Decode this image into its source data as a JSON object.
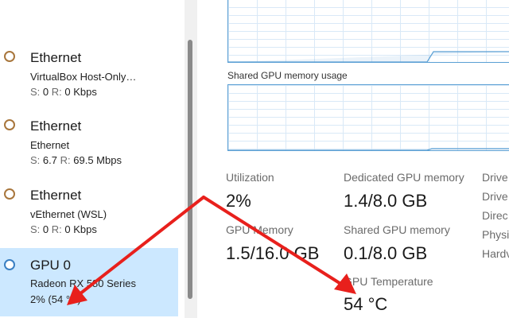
{
  "sidebar": {
    "items": [
      {
        "title": "Ethernet",
        "subtitle": "VirtualBox Host-Only…",
        "send_label": "S:",
        "send_value": "0",
        "recv_label": "R:",
        "recv_value": "0 Kbps"
      },
      {
        "title": "Ethernet",
        "subtitle": "Ethernet",
        "send_label": "S:",
        "send_value": "6.7",
        "recv_label": "R:",
        "recv_value": "69.5 Mbps"
      },
      {
        "title": "Ethernet",
        "subtitle": "vEthernet (WSL)",
        "send_label": "S:",
        "send_value": "0",
        "recv_label": "R:",
        "recv_value": "0 Kbps"
      }
    ],
    "gpu": {
      "title": "GPU 0",
      "subtitle": "Radeon RX 580 Series",
      "usage": "2%",
      "temp": "(54 °C)"
    }
  },
  "graphs": {
    "shared_label": "Shared GPU memory usage"
  },
  "stats": {
    "utilization_label": "Utilization",
    "utilization_value": "2%",
    "dedicated_label": "Dedicated GPU memory",
    "dedicated_value": "1.4/8.0 GB",
    "gpu_memory_label": "GPU Memory",
    "gpu_memory_value": "1.5/16.0 GB",
    "shared_label": "Shared GPU memory",
    "shared_value": "0.1/8.0 GB",
    "temp_label": "GPU Temperature",
    "temp_value": "54 °C"
  },
  "side_labels": [
    "Drive",
    "Drive",
    "Direc",
    "Physi",
    "Hardv"
  ],
  "colors": {
    "selection": "#cce8ff",
    "graph_border": "#5a9fd4",
    "arrow": "#e8201c",
    "ethernet_ring": "#a8763c",
    "gpu_ring": "#3a7fc2"
  }
}
